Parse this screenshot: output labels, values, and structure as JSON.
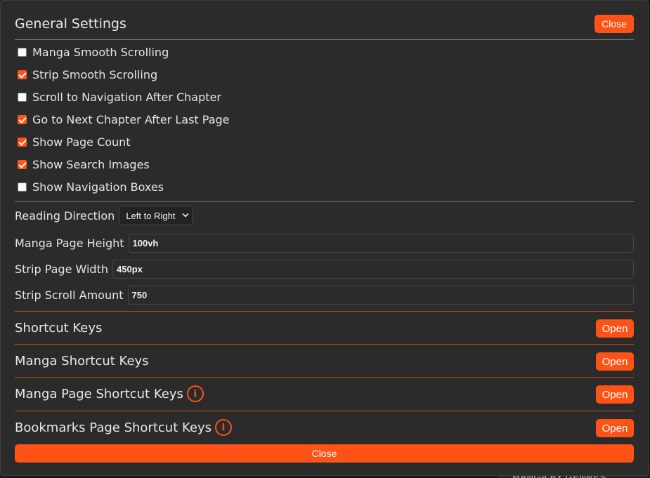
{
  "header": {
    "title": "General Settings",
    "close_label": "Close"
  },
  "checkboxes": [
    {
      "label": "Manga Smooth Scrolling",
      "checked": false
    },
    {
      "label": "Strip Smooth Scrolling",
      "checked": true
    },
    {
      "label": "Scroll to Navigation After Chapter",
      "checked": false
    },
    {
      "label": "Go to Next Chapter After Last Page",
      "checked": true
    },
    {
      "label": "Show Page Count",
      "checked": true
    },
    {
      "label": "Show Search Images",
      "checked": true
    },
    {
      "label": "Show Navigation Boxes",
      "checked": false
    }
  ],
  "fields": {
    "reading_direction": {
      "label": "Reading Direction",
      "value": "Left to Right"
    },
    "manga_page_height": {
      "label": "Manga Page Height",
      "value": "100vh"
    },
    "strip_page_width": {
      "label": "Strip Page Width",
      "value": "450px"
    },
    "strip_scroll_amount": {
      "label": "Strip Scroll Amount",
      "value": "750"
    }
  },
  "sections": [
    {
      "title": "Shortcut Keys",
      "button": "Open",
      "info": false
    },
    {
      "title": "Manga Shortcut Keys",
      "button": "Open",
      "info": false
    },
    {
      "title": "Manga Page Shortcut Keys",
      "button": "Open",
      "info": true
    },
    {
      "title": "Bookmarks Page Shortcut Keys",
      "button": "Open",
      "info": true
    }
  ],
  "footer": {
    "close_label": "Close"
  },
  "background": {
    "peek_text": "MANGA BY GENRES"
  },
  "colors": {
    "accent": "#ff5216",
    "panel": "#2b2b2b"
  }
}
